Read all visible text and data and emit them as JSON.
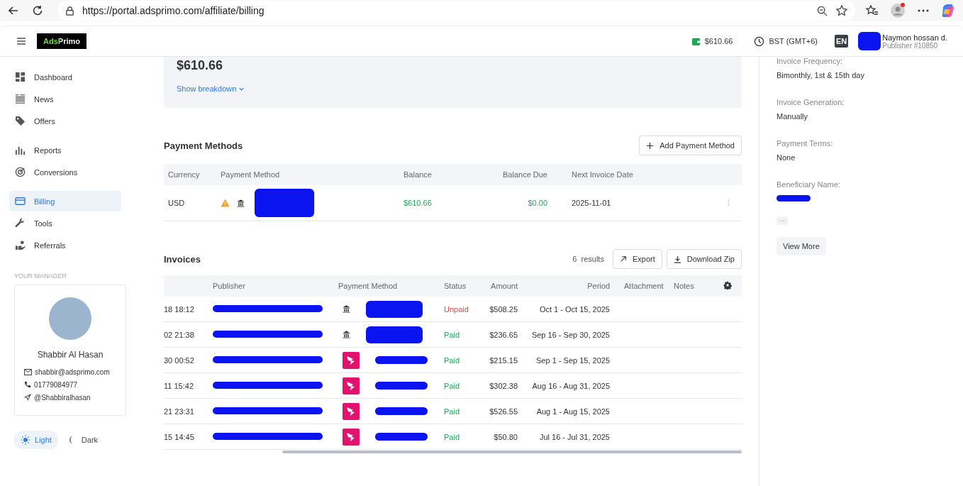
{
  "browser": {
    "url": "https://portal.adsprimo.com/affiliate/billing"
  },
  "header": {
    "logo": "AdsPrimo",
    "balance": "$610.66",
    "timezone": "BST (GMT+6)",
    "language": "EN",
    "user_name": "Naymon hossan d.",
    "user_role": "Publisher #10850"
  },
  "sidebar": {
    "groups": [
      [
        {
          "label": "Dashboard",
          "selected": false
        },
        {
          "label": "News",
          "selected": false
        },
        {
          "label": "Offers",
          "selected": false
        }
      ],
      [
        {
          "label": "Reports",
          "selected": false
        },
        {
          "label": "Conversions",
          "selected": false
        }
      ],
      [
        {
          "label": "Billing",
          "selected": true
        },
        {
          "label": "Tools",
          "selected": false
        },
        {
          "label": "Referrals",
          "selected": false
        }
      ]
    ],
    "manager_heading": "YOUR MANAGER",
    "manager": {
      "name": "Shabbir Al Hasan",
      "email": "shabbir@adsprimo.com",
      "phone": "01779084977",
      "telegram": "@Shabbiralhasan"
    },
    "theme": [
      {
        "label": "Light",
        "selected": true
      },
      {
        "label": "Dark",
        "selected": false
      }
    ]
  },
  "summary": {
    "amount": "$610.66",
    "link": "Show breakdown"
  },
  "payment_methods": {
    "title": "Payment Methods",
    "add_button": "Add Payment Method",
    "columns": [
      "Currency",
      "Payment Method",
      "Balance",
      "Balance Due",
      "Next Invoice Date"
    ],
    "rows": [
      {
        "currency": "USD",
        "warning": true,
        "balance": "$610.66",
        "balance_due": "$0.00",
        "next_invoice_date": "2025-11-01"
      }
    ]
  },
  "invoices": {
    "title": "Invoices",
    "count": "6",
    "count_label": "results",
    "export_button": "Export",
    "download_button": "Download Zip",
    "columns": [
      "Publisher",
      "Payment Method",
      "Status",
      "Amount",
      "Period",
      "Attachment",
      "Notes"
    ],
    "rows": [
      {
        "date": "18 18:12",
        "kind": "bank",
        "status": "Unpaid",
        "paid": false,
        "amount": "$508.25",
        "period": "Oct 1 - Oct 15, 2025"
      },
      {
        "date": "02 21:38",
        "kind": "bank",
        "status": "Paid",
        "paid": true,
        "amount": "$236.65",
        "period": "Sep 16 - Sep 30, 2025"
      },
      {
        "date": "30 00:52",
        "kind": "app",
        "status": "Paid",
        "paid": true,
        "amount": "$215.15",
        "period": "Sep 1 - Sep 15, 2025"
      },
      {
        "date": "11 15:42",
        "kind": "app",
        "status": "Paid",
        "paid": true,
        "amount": "$302.38",
        "period": "Aug 16 - Aug 31, 2025"
      },
      {
        "date": "21 23:31",
        "kind": "app",
        "status": "Paid",
        "paid": true,
        "amount": "$526.55",
        "period": "Aug 1 - Aug 15, 2025"
      },
      {
        "date": "15 14:45",
        "kind": "app",
        "status": "Paid",
        "paid": true,
        "amount": "$50.80",
        "period": "Jul 16 - Jul 31, 2025"
      }
    ]
  },
  "details": {
    "fields": [
      {
        "label": "Invoice Frequency:",
        "value": "Bimonthly, 1st & 15th day"
      },
      {
        "label": "Invoice Generation:",
        "value": "Manually"
      },
      {
        "label": "Payment Terms:",
        "value": "None"
      },
      {
        "label": "Beneficiary Name:",
        "redacted": true
      }
    ],
    "more_tag": "···",
    "view_more_button": "View More"
  }
}
